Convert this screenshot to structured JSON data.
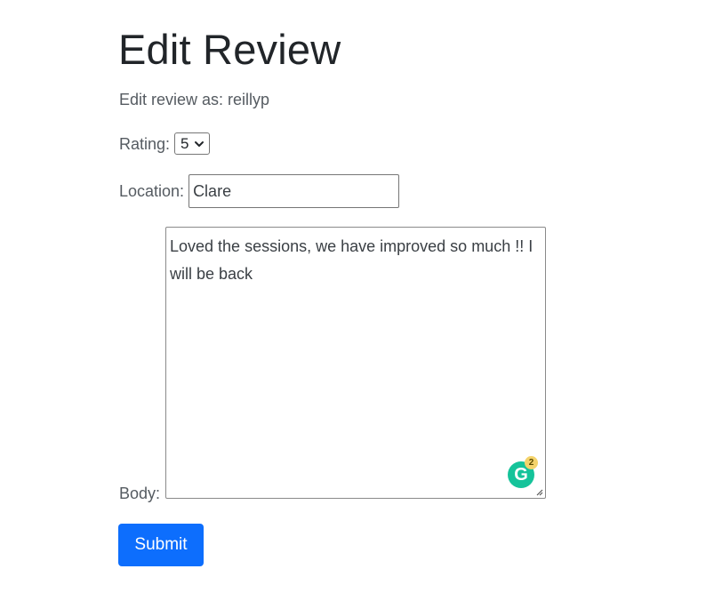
{
  "page": {
    "title": "Edit Review",
    "subtitle": "Edit review as: reillyp"
  },
  "form": {
    "rating_label": "Rating:",
    "rating_value": "5",
    "location_label": "Location:",
    "location_value": "Clare",
    "body_label": "Body:",
    "body_value": "Loved the sessions, we have improved so much !! I will be back",
    "submit_label": "Submit"
  },
  "grammarly": {
    "icon": "grammarly-icon",
    "glyph": "G",
    "badge_count": "2",
    "color": "#15c39a"
  },
  "colors": {
    "primary": "#0d6efd",
    "text": "#212529",
    "muted": "#555b61"
  }
}
